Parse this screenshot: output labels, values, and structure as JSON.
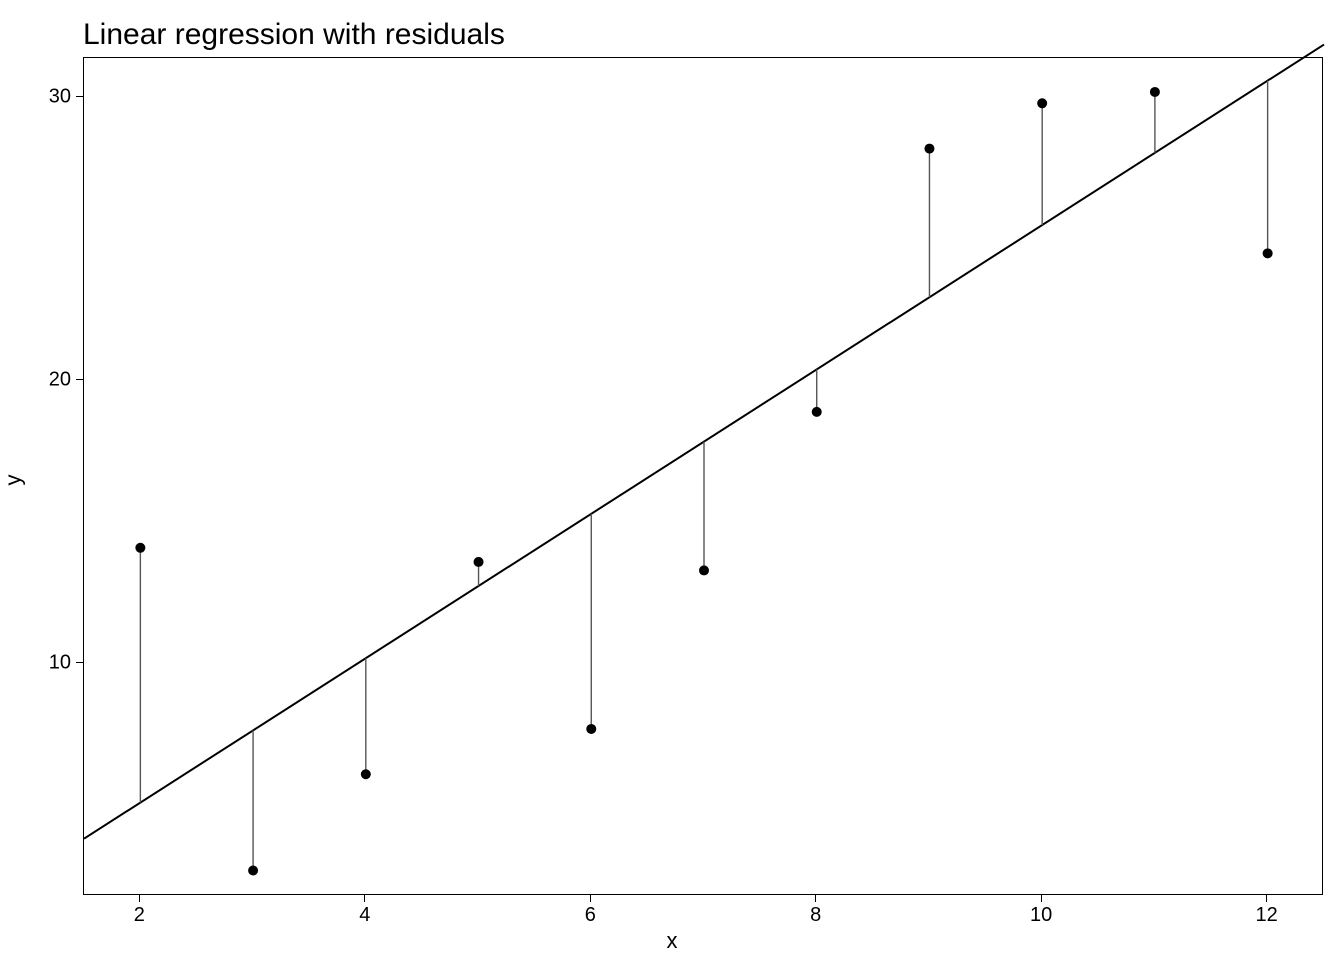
{
  "chart_data": {
    "type": "scatter",
    "title": "Linear regression with residuals",
    "xlabel": "x",
    "ylabel": "y",
    "x_ticks": [
      2,
      4,
      6,
      8,
      10,
      12
    ],
    "y_ticks": [
      10,
      20,
      30
    ],
    "xlim": [
      1.5,
      12.5
    ],
    "ylim": [
      1.8,
      31.4
    ],
    "x": [
      2,
      3,
      4,
      5,
      6,
      7,
      8,
      9,
      10,
      11,
      12
    ],
    "y": [
      14.1,
      2.7,
      6.1,
      13.6,
      7.7,
      13.3,
      18.9,
      28.2,
      29.8,
      30.2,
      24.5
    ],
    "regression": {
      "intercept": 0.0,
      "slope": 2.55
    },
    "residual_color": "#555555",
    "line_color": "#000000",
    "point_color": "#000000"
  }
}
